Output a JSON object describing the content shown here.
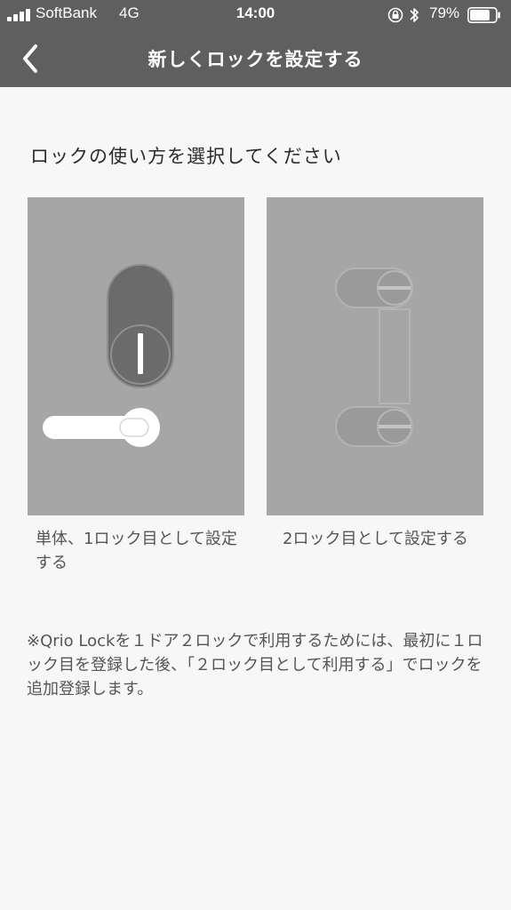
{
  "status_bar": {
    "carrier": "SoftBank",
    "network": "4G",
    "time": "14:00",
    "battery_percent": "79%",
    "battery_level": 0.79,
    "signal_bars": 4
  },
  "nav": {
    "back_icon": "chevron-left-icon",
    "title": "新しくロックを設定する"
  },
  "main": {
    "prompt": "ロックの使い方を選択してください",
    "options": [
      {
        "id": "single",
        "label": "単体、1ロック目として設定する",
        "icon": "single-lock-icon"
      },
      {
        "id": "second",
        "label": "2ロック目として設定する",
        "icon": "double-lock-icon"
      }
    ],
    "note": "※Qrio Lockを１ドア２ロックで利用するためには、最初に１ロック目を登録した後、「２ロック目として利用する」でロックを追加登録します。"
  },
  "colors": {
    "header_bg": "#5f5f5f",
    "page_bg": "#f7f7f8",
    "card_bg": "#a6a6a6"
  }
}
